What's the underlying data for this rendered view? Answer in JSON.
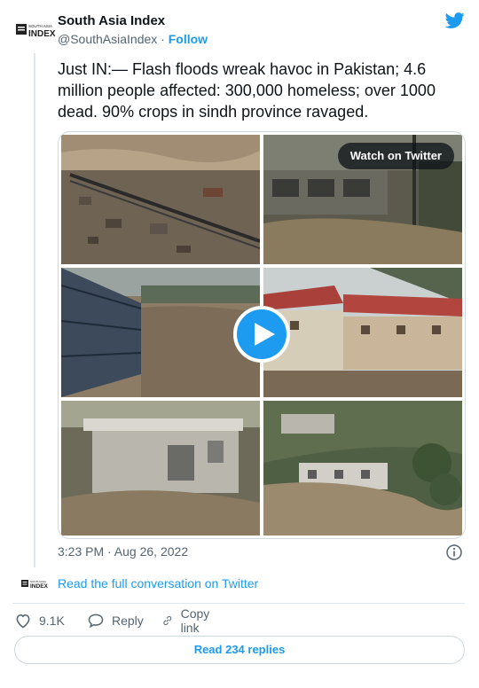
{
  "author": {
    "name": "South Asia Index",
    "handle": "@SouthAsiaIndex",
    "separator": " · ",
    "follow_label": "Follow",
    "avatar_text_top": "SOUTH ASIA",
    "avatar_text_main": "INDEX"
  },
  "tweet": {
    "text": "Just IN:— Flash floods wreak havoc in Pakistan; 4.6 million people affected: 300,000 homeless; over 1000 dead. 90% crops in sindh province ravaged.",
    "timestamp": "3:23 PM · Aug 26, 2022"
  },
  "media": {
    "watch_label": "Watch on Twitter"
  },
  "conversation": {
    "link_label": "Read the full conversation on Twitter"
  },
  "actions": {
    "like_count": "9.1K",
    "reply_label": "Reply",
    "copy_label": "Copy link"
  },
  "replies_button": "Read 234 replies",
  "colors": {
    "accent": "#1d9bf0",
    "muted": "#536471",
    "border": "#cfd9de"
  }
}
